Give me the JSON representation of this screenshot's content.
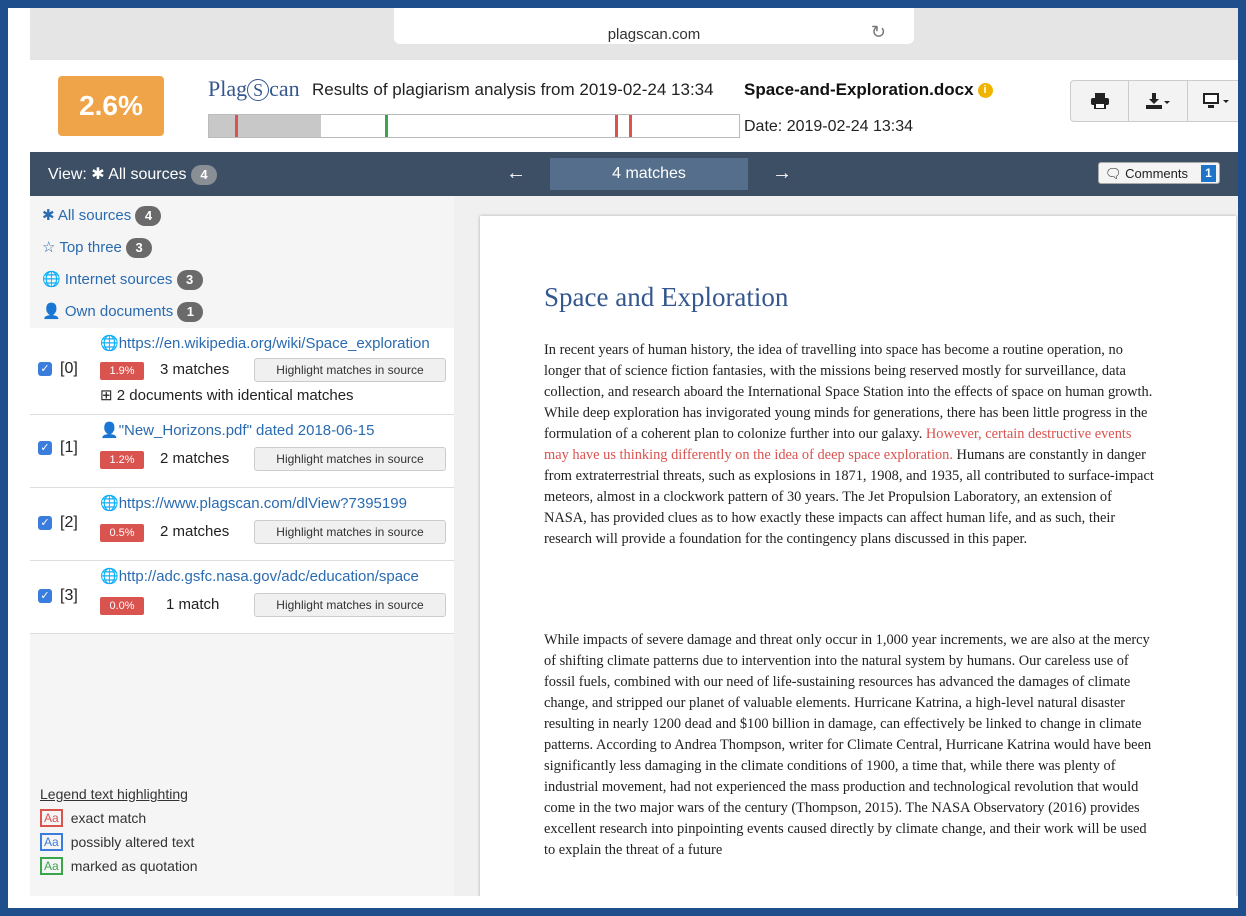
{
  "browser": {
    "url": "plagscan.com"
  },
  "header": {
    "score": "2.6%",
    "logo": "PlagScan",
    "results_text": "Results of plagiarism analysis from 2019-02-24 13:34",
    "filename": "Space-and-Exploration.docx",
    "date": "Date: 2019-02-24 13:34",
    "toolbar": {
      "print_icon": "print-icon",
      "download_icon": "download-icon",
      "display_icon": "monitor-icon"
    }
  },
  "nav": {
    "view_label": "View: ✱ All sources",
    "view_count": "4",
    "matches": "4 matches",
    "comments_label": "Comments",
    "comments_count": "1"
  },
  "filters": [
    {
      "label": "✱ All sources",
      "count": "4"
    },
    {
      "label": "☆ Top three",
      "count": "3"
    },
    {
      "label": "Internet sources",
      "count": "3"
    },
    {
      "label": "Own documents",
      "count": "1"
    }
  ],
  "sources": [
    {
      "idx": "[0]",
      "url": "https://en.wikipedia.org/wiki/Space_exploration",
      "pct": "1.9%",
      "matches": "3 matches",
      "highlight": "Highlight matches in source",
      "identical": "2 documents with identical matches"
    },
    {
      "idx": "[1]",
      "url": "\"New_Horizons.pdf\" dated 2018-06-15",
      "pct": "1.2%",
      "matches": "2 matches",
      "highlight": "Highlight matches in source"
    },
    {
      "idx": "[2]",
      "url": "https://www.plagscan.com/dlView?7395199",
      "pct": "0.5%",
      "matches": "2 matches",
      "highlight": "Highlight matches in source"
    },
    {
      "idx": "[3]",
      "url": "http://adc.gsfc.nasa.gov/adc/education/space",
      "pct": "0.0%",
      "matches": "1 match",
      "highlight": "Highlight matches in source"
    }
  ],
  "legend": {
    "title": "Legend text highlighting",
    "sample": "Aa",
    "items": [
      {
        "label": "exact match",
        "color": "#d9534f"
      },
      {
        "label": "possibly altered text",
        "color": "#3b7ddd"
      },
      {
        "label": "marked as quotation",
        "color": "#3aa64b"
      }
    ]
  },
  "document": {
    "title": "Space and Exploration",
    "p1_before": "In recent years of human history, the idea of travelling into space has become a routine operation, no longer that of science fiction fantasies, with the missions being reserved mostly for surveillance, data collection, and research aboard the International Space Station into the effects of space on human growth. While deep exploration has invigorated young minds for generations, there has been little progress in the formulation of a coherent plan to colonize further into our galaxy. ",
    "p1_highlight": "However, certain destructive events may have us thinking differently on the idea of deep space exploration.",
    "p1_after": " Humans are constantly in danger from extraterrestrial threats, such as explosions in 1871, 1908, and 1935, all contributed to surface-impact meteors, almost in a clockwork pattern of 30 years. The Jet Propulsion Laboratory, an extension of NASA, has provided clues as to how exactly these impacts can affect human life, and as such, their research will provide a foundation for the contingency plans discussed in this paper.",
    "p2": "While impacts of severe damage and threat only occur in 1,000 year increments, we are also at the mercy of shifting climate patterns due to intervention into the natural system by humans. Our careless use of fossil fuels, combined with our need of life-sustaining resources has advanced the damages of climate change, and stripped our planet of valuable elements. Hurricane Katrina, a high-level natural disaster resulting in nearly 1200 dead and $100 billion in damage, can effectively be linked to change in climate patterns. According to Andrea Thompson, writer for Climate Central, Hurricane Katrina would have been significantly less damaging in the climate conditions of 1900, a time that, while there was plenty of industrial movement, had not experienced the mass production and technological revolution that would come in the two major wars of the century (Thompson, 2015). The NASA Observatory (2016) provides excellent research into pinpointing events caused directly by climate change, and their work will be used to explain the threat of a future"
  },
  "colors": {
    "score_bg": "#f0a449",
    "navbar": "#3d4f64",
    "exact": "#d9534f",
    "altered": "#3b7ddd",
    "quotation": "#3aa64b"
  }
}
